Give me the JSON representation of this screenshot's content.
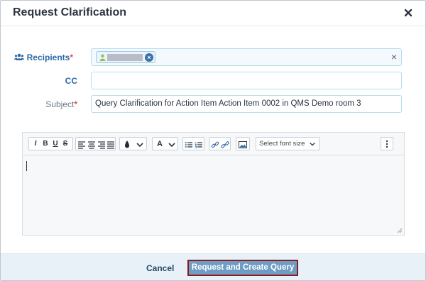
{
  "dialog": {
    "title": "Request Clarification"
  },
  "form": {
    "recipients_label": "Recipients",
    "cc_label": "CC",
    "subject_label": "Subject",
    "required_marker": "*",
    "subject_value": "Query Clarification for Action Item Action Item 0002 in QMS Demo room 3",
    "cc_value": ""
  },
  "editor": {
    "font_size_placeholder": "Select font size",
    "toolbar_icons": [
      "italic-icon",
      "bold-icon",
      "underline-icon",
      "strikethrough-icon",
      "align-left-icon",
      "align-center-icon",
      "align-right-icon",
      "align-justify-icon",
      "text-color-icon",
      "font-icon",
      "bullet-list-icon",
      "numbered-list-icon",
      "link-icon",
      "unlink-icon",
      "image-icon",
      "more-icon"
    ]
  },
  "footer": {
    "cancel_label": "Cancel",
    "primary_label": "Request and Create Query"
  },
  "colors": {
    "accent_blue": "#2d6aa5",
    "primary_button": "#6f9cc4",
    "primary_border": "#8b1a1a",
    "required": "#d9534f",
    "footer_bg": "#e8f0f8"
  }
}
